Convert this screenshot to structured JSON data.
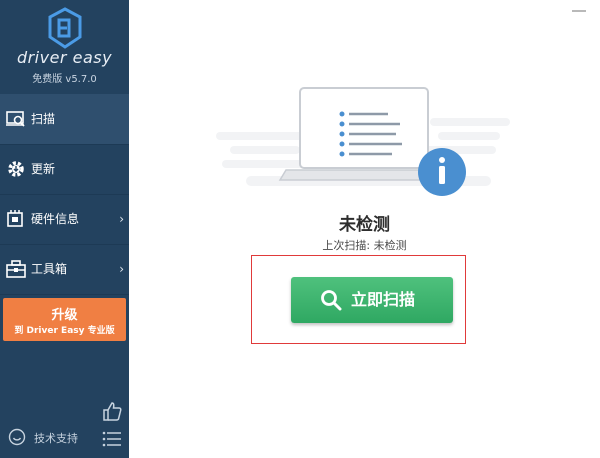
{
  "app": {
    "brand": "driver easy",
    "version": "免费版 v5.7.0"
  },
  "sidebar": {
    "items": [
      {
        "label": "扫描",
        "icon": "scan-icon",
        "active": true,
        "has_chevron": false
      },
      {
        "label": "更新",
        "icon": "update-gear-icon",
        "active": false,
        "has_chevron": false
      },
      {
        "label": "硬件信息",
        "icon": "hardware-info-icon",
        "active": false,
        "has_chevron": true
      },
      {
        "label": "工具箱",
        "icon": "toolbox-icon",
        "active": false,
        "has_chevron": true
      }
    ],
    "chevron": "›",
    "upgrade": {
      "title": "升级",
      "subtitle": "到 Driver Easy 专业版"
    },
    "support_label": "技术支持"
  },
  "window": {
    "minimize_glyph": "—"
  },
  "main": {
    "status_title": "未检测",
    "last_scan": "上次扫描: 未检测",
    "scan_button_label": "立即扫描"
  },
  "colors": {
    "sidebar_bg": "#23425f",
    "sidebar_active": "#2f4f6e",
    "upgrade_orange": "#f07f43",
    "scan_green": "#3bb36c",
    "info_blue": "#4a8fd0",
    "highlight_red": "#e03a3a"
  }
}
